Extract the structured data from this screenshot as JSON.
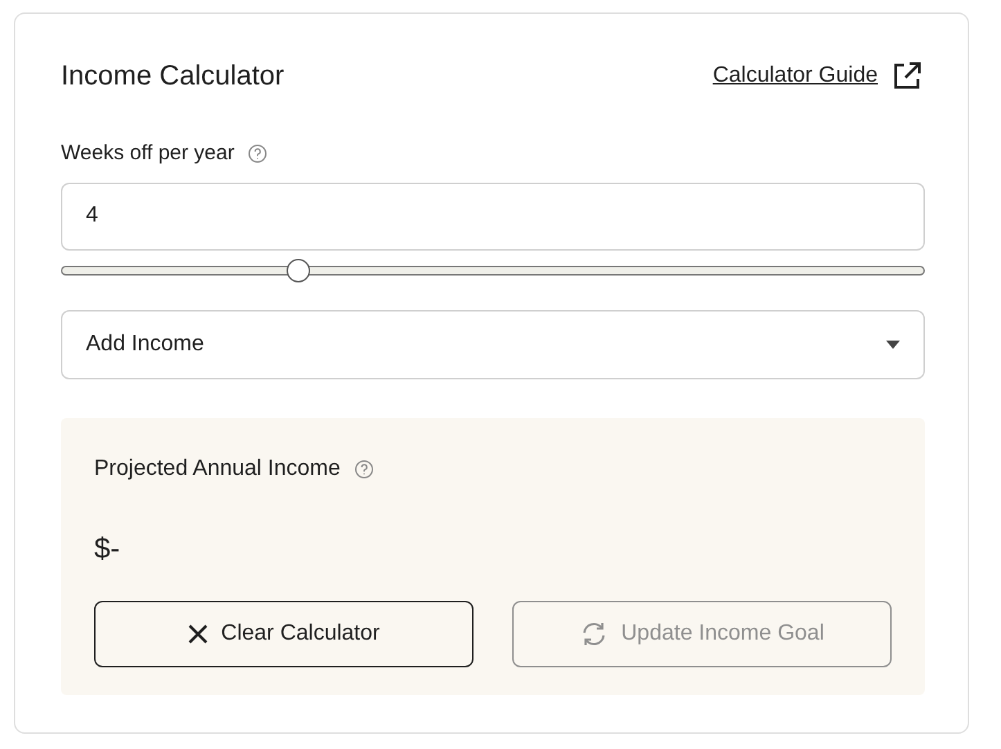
{
  "title": "Income Calculator",
  "guide_link": {
    "label": "Calculator Guide"
  },
  "weeks_off": {
    "label": "Weeks off per year",
    "value": "4",
    "level": 0.274
  },
  "income_select": {
    "value": "Add Income"
  },
  "projection": {
    "label": "Projected Annual Income",
    "amount": "$-"
  },
  "buttons": [
    {
      "kind": "clear",
      "label": "Clear Calculator",
      "disabled": false
    },
    {
      "kind": "update",
      "label": "Update Income Goal",
      "disabled": true
    }
  ]
}
